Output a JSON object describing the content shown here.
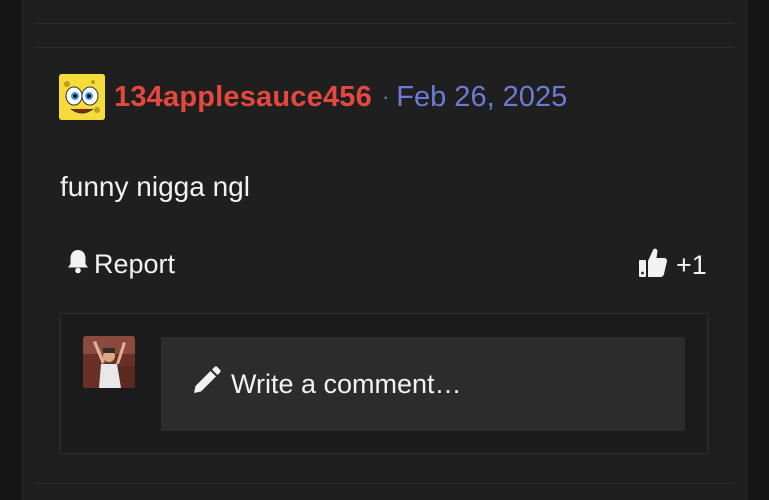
{
  "post": {
    "author": "134applesauce456",
    "separator": "·",
    "date": "Feb 26, 2025",
    "body": "funny nigga ngl"
  },
  "actions": {
    "report_label": "Report",
    "like_count": "+1"
  },
  "comment": {
    "placeholder": "Write a comment…"
  },
  "icons": {
    "report": "bell-icon",
    "like": "thumbs-up-icon",
    "compose": "pencil-icon"
  },
  "colors": {
    "author": "#e5483f",
    "date": "#6d7ad6",
    "text": "#f2f2f2",
    "panel": "#1f1f1f",
    "input": "#2c2c2c"
  }
}
